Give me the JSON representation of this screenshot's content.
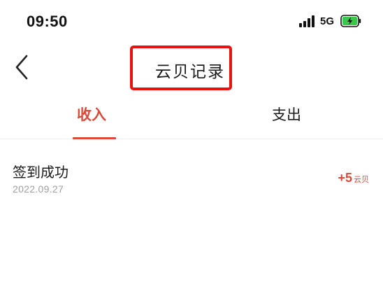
{
  "status_bar": {
    "time": "09:50",
    "network": "5G",
    "icons": [
      "signal-icon",
      "battery-charging-icon"
    ]
  },
  "nav": {
    "back_icon": "chevron-left-icon",
    "title": "云贝记录",
    "highlight_color": "#e8130f"
  },
  "tabs": {
    "income": "收入",
    "expense": "支出",
    "active": "income",
    "accent_color": "#d84a3a"
  },
  "records": [
    {
      "title": "签到成功",
      "date": "2022.09.27",
      "amount": "+5",
      "unit": "云贝"
    }
  ]
}
